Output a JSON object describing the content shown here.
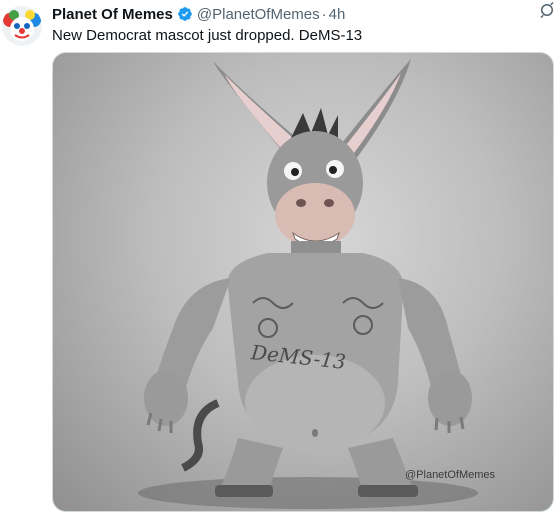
{
  "tweet": {
    "author_name": "Planet Of Memes",
    "handle": "@PlanetOfMemes",
    "separator": "·",
    "time": "4h",
    "text": "New Democrat mascot just dropped. DeMS-13"
  },
  "media": {
    "chest_text": "DeMS-13",
    "watermark": "@PlanetOfMemes"
  },
  "colors": {
    "verified": "#1d9bf0",
    "secondary_text": "#536471"
  },
  "icons": {
    "verified": "verified-badge-icon",
    "grok": "grok-icon"
  }
}
